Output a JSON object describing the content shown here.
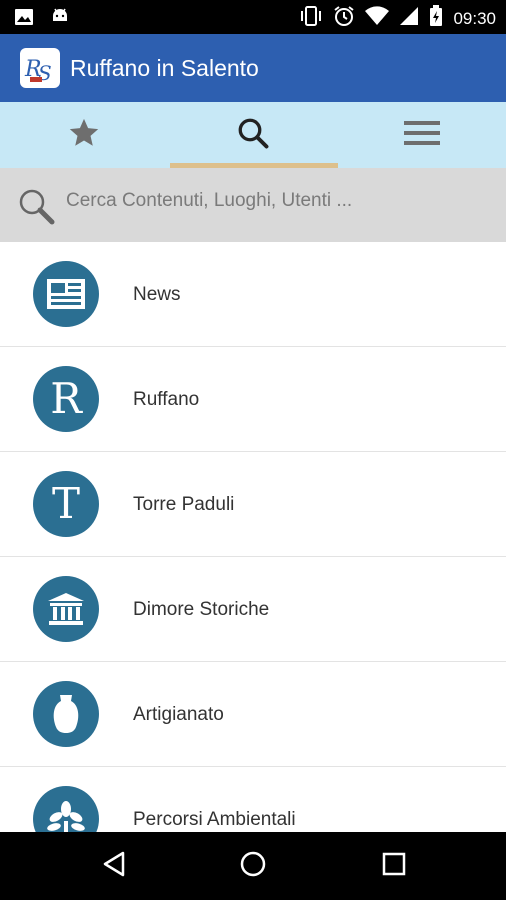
{
  "status_bar": {
    "time": "09:30",
    "icons": [
      "image-icon",
      "android-icon",
      "vibrate-icon",
      "alarm-icon",
      "wifi-icon",
      "signal-icon",
      "battery-icon"
    ]
  },
  "app_bar": {
    "title": "Ruffano in Salento",
    "logo_text": "RS",
    "color": "#2d5fb0"
  },
  "tabs": [
    {
      "icon": "star-icon",
      "selected": false
    },
    {
      "icon": "search-icon",
      "selected": true
    },
    {
      "icon": "menu-icon",
      "selected": false
    }
  ],
  "search": {
    "placeholder": "Cerca Contenuti, Luoghi, Utenti ..."
  },
  "list": [
    {
      "label": "News",
      "icon": "newspaper-icon"
    },
    {
      "label": "Ruffano",
      "icon": "letter-r-icon",
      "glyph": "R"
    },
    {
      "label": "Torre Paduli",
      "icon": "letter-t-icon",
      "glyph": "T"
    },
    {
      "label": "Dimore Storiche",
      "icon": "building-icon"
    },
    {
      "label": "Artigianato",
      "icon": "vase-icon"
    },
    {
      "label": "Percorsi Ambientali",
      "icon": "tree-icon"
    }
  ],
  "nav_bar": {
    "icons": [
      "back-icon",
      "home-icon",
      "recents-icon"
    ]
  },
  "colors": {
    "tab_bar": "#c7e8f6",
    "tab_indicator": "#ddc08c",
    "list_icon": "#2b6f92"
  }
}
